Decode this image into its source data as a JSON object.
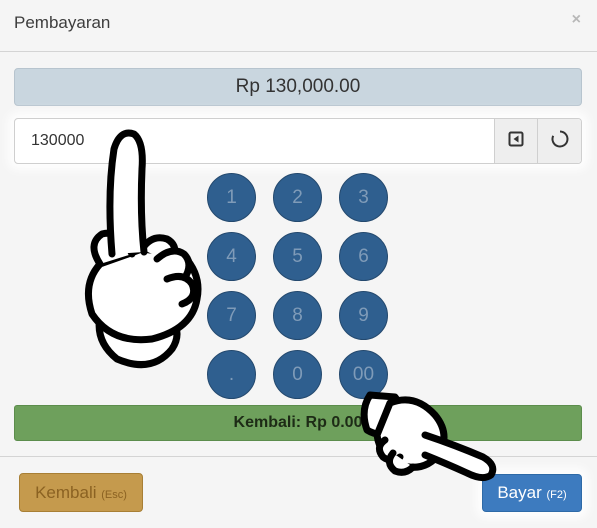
{
  "modal": {
    "title": "Pembayaran",
    "close_label": "×"
  },
  "total": {
    "label": "Rp 130,000.00"
  },
  "amount_input": {
    "value": "130000"
  },
  "keypad": {
    "keys": [
      "1",
      "2",
      "3",
      "4",
      "5",
      "6",
      "7",
      "8",
      "9",
      ".",
      "0",
      "00"
    ]
  },
  "change": {
    "label": "Kembali: Rp 0.00"
  },
  "footer": {
    "back_label": "Kembali",
    "back_shortcut": "(Esc)",
    "pay_label": "Bayar",
    "pay_shortcut": "(F2)"
  },
  "icons": {
    "backspace": "backspace-icon",
    "reset": "reset-icon",
    "pointer_up": "pointing-hand-icon",
    "pointer_right": "pointing-hand-icon"
  },
  "colors": {
    "key_bg": "#2f5f8f",
    "change_bg": "#6ea05c",
    "back_button": "#c59a4d",
    "pay_button": "#3d7bbf",
    "total_bg": "#c9d6df"
  }
}
